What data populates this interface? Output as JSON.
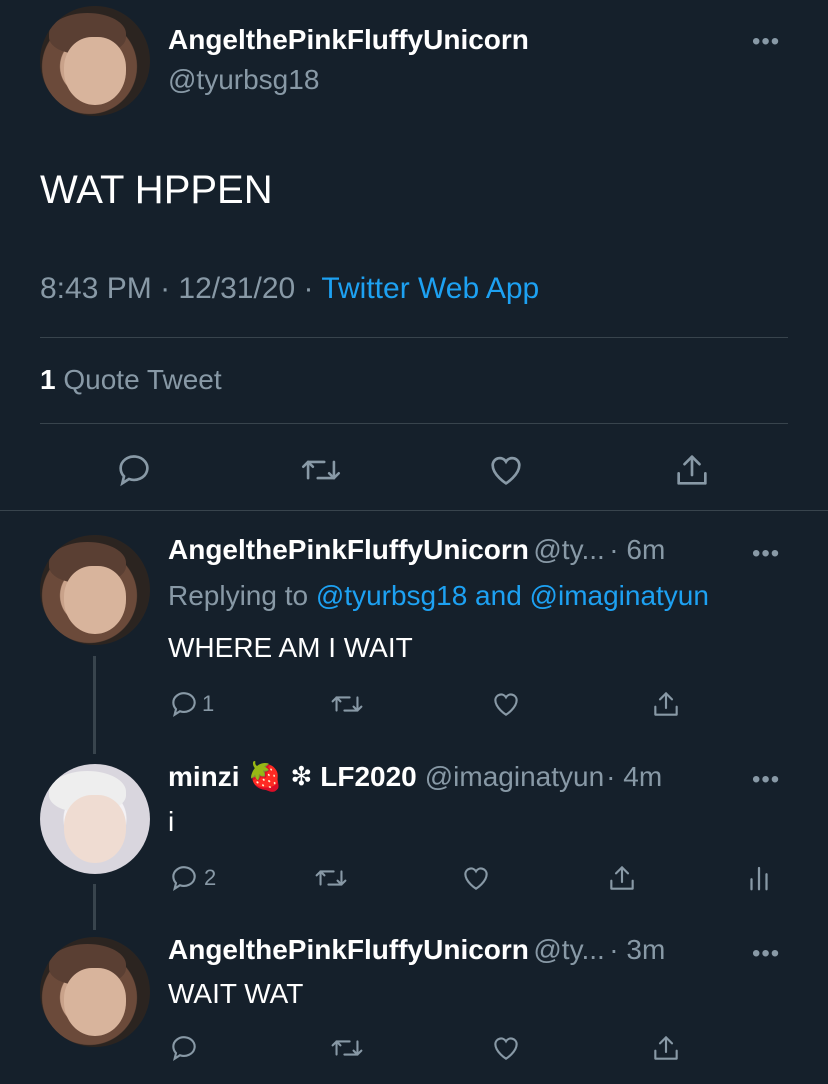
{
  "main_tweet": {
    "author_name": "AngelthePinkFluffyUnicorn",
    "author_handle": "@tyurbsg18",
    "text": "WAT HPPEN",
    "time": "8:43 PM",
    "sep1": "·",
    "date": "12/31/20",
    "sep2": "·",
    "source": "Twitter Web App",
    "quote_count": "1",
    "quote_label": "Quote Tweet",
    "more": "•••"
  },
  "replies": [
    {
      "author_name": "AngelthePinkFluffyUnicorn",
      "author_handle": "@ty...",
      "age": "· 6m",
      "replying_prefix": "Replying to",
      "replying_user1": "@tyurbsg18",
      "replying_and": "and",
      "replying_user2": "@imaginatyun",
      "text": "WHERE AM I WAIT",
      "reply_count": "1",
      "more": "•••"
    },
    {
      "author_name": "minzi",
      "author_emoji_1": "🍓",
      "author_emoji_2": "❇",
      "author_suffix": "LF2020",
      "author_handle": "@imaginatyun",
      "age": "· 4m",
      "text": "i",
      "reply_count": "2",
      "more": "•••"
    },
    {
      "author_name": "AngelthePinkFluffyUnicorn",
      "author_handle": "@ty...",
      "age": "· 3m",
      "text": "WAIT WAT",
      "more": "•••"
    }
  ],
  "icons": {
    "reply": "reply-icon",
    "retweet": "retweet-icon",
    "like": "like-icon",
    "share": "share-icon",
    "analytics": "analytics-icon"
  },
  "colors": {
    "background": "#15202b",
    "text": "#ffffff",
    "muted": "#8899a6",
    "link": "#1da1f2",
    "divider": "#38444d"
  }
}
